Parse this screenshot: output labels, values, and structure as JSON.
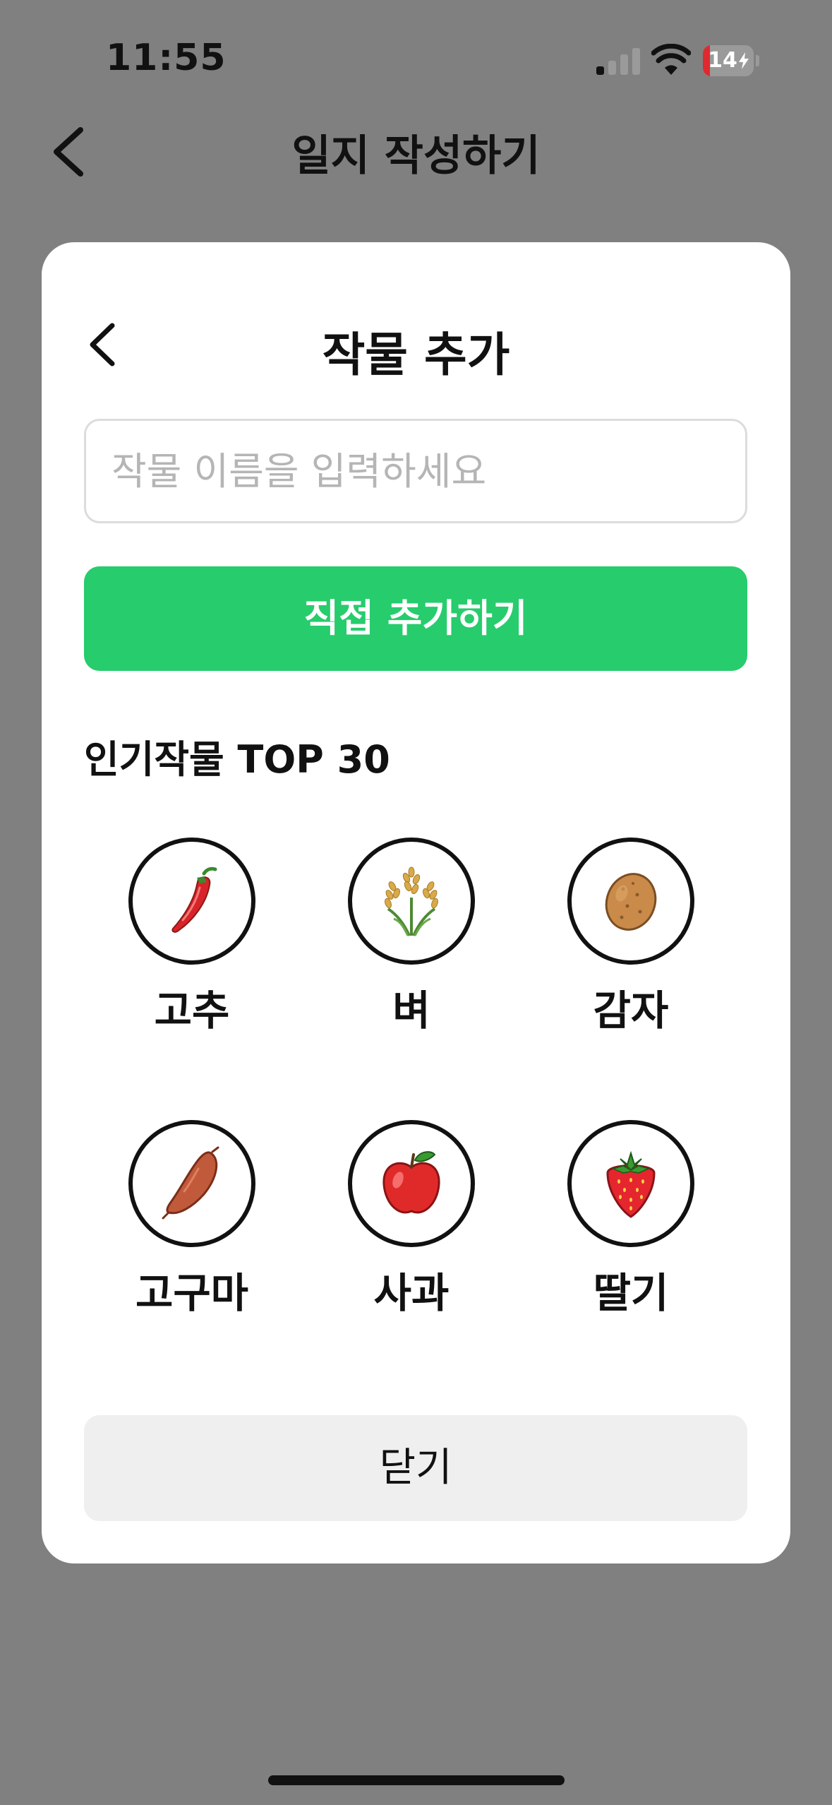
{
  "status_bar": {
    "time": "11:55",
    "battery_level": "14",
    "battery_fraction": 0.14,
    "battery_color": "#e0292e",
    "icons": [
      "signal-icon",
      "wifi-icon",
      "battery-icon",
      "bolt-icon"
    ]
  },
  "header": {
    "title": "일지 작성하기",
    "back_icon": "chevron-left-icon"
  },
  "modal": {
    "title": "작물 추가",
    "back_icon": "chevron-left-icon",
    "search": {
      "placeholder": "작물 이름을 입력하세요",
      "value": ""
    },
    "add_button_label": "직접 추가하기",
    "add_button_color": "#27cc6d",
    "section_title": "인기작물 TOP 30",
    "crops": [
      {
        "label": "고추",
        "icon": "chili-pepper-icon"
      },
      {
        "label": "벼",
        "icon": "rice-plant-icon"
      },
      {
        "label": "감자",
        "icon": "potato-icon"
      },
      {
        "label": "고구마",
        "icon": "sweet-potato-icon"
      },
      {
        "label": "사과",
        "icon": "apple-icon"
      },
      {
        "label": "딸기",
        "icon": "strawberry-icon"
      }
    ],
    "close_button_label": "닫기"
  }
}
